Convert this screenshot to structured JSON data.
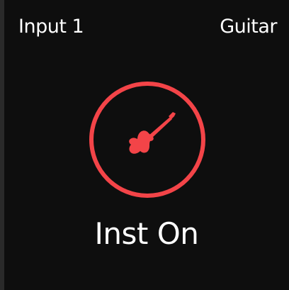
{
  "header": {
    "input_label": "Input 1",
    "instrument_label": "Guitar"
  },
  "button": {
    "icon": "guitar-icon",
    "status": "Inst On"
  },
  "colors": {
    "accent": "#f34448",
    "background": "#0e0e0e",
    "text": "#ffffff"
  }
}
